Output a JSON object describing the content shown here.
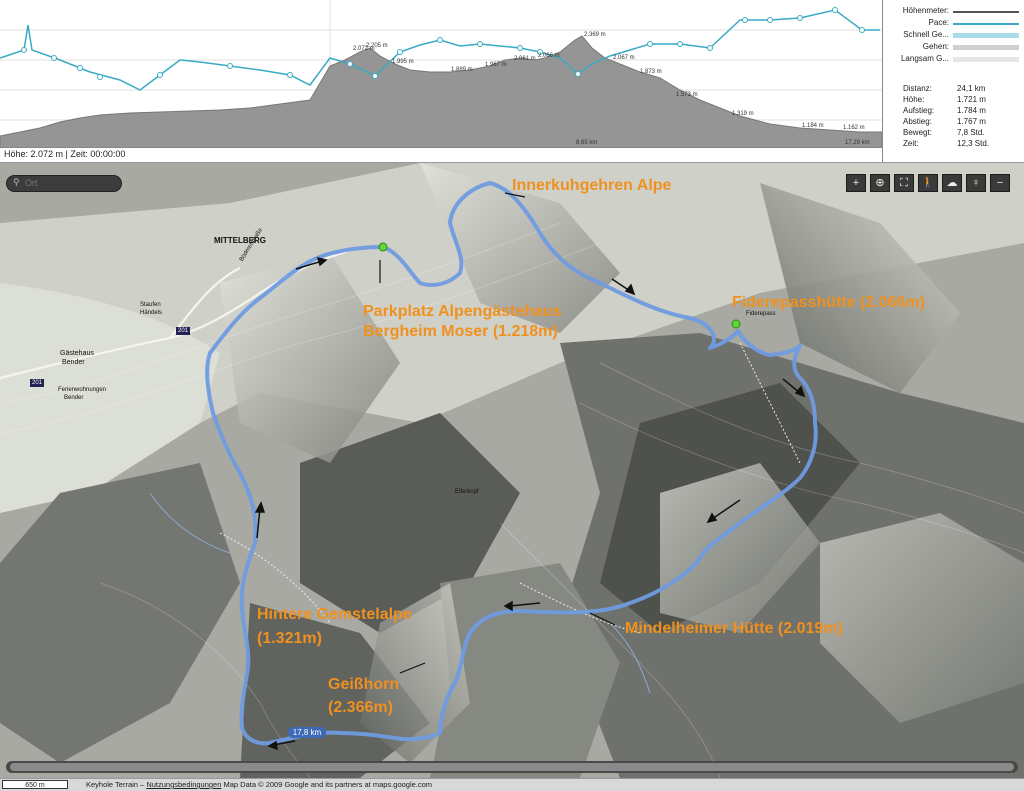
{
  "profile": {
    "status": "Höhe: 2.072 m | Zeit: 00:00:00",
    "peak_labels": [
      "2.072 m",
      "2.205 m",
      "1.995 m",
      "1.889 m",
      "1.967 m",
      "2.061 m",
      "2.066 m",
      "2.369 m",
      "2.067 m",
      "1.873 m",
      "1.573 m",
      "1.319 m",
      "1.184 m",
      "1.162 m"
    ],
    "distance_labels": [
      "8,65 km",
      "17,29 km"
    ],
    "colors": {
      "elevation_fill": "#8f8f8f",
      "pace_line": "#3aaac4",
      "grid": "#dddddd"
    }
  },
  "legend": {
    "items": [
      {
        "label": "Höhenmeter:",
        "color": "#555555"
      },
      {
        "label": "Pace:",
        "color": "#3aaac4"
      },
      {
        "label": "Schnell Ge...",
        "color": "#aadbe8"
      },
      {
        "label": "Gehen:",
        "color": "#d0d0d0"
      },
      {
        "label": "Langsam G...",
        "color": "#e6e6e6"
      }
    ],
    "stats": [
      {
        "key": "Distanz:",
        "value": "24,1 km"
      },
      {
        "key": "Höhe:",
        "value": "1.721 m"
      },
      {
        "key": "Aufstieg:",
        "value": "1.784 m"
      },
      {
        "key": "Abstieg:",
        "value": "1.767 m"
      },
      {
        "key": "Bewegt:",
        "value": "7,8 Std."
      },
      {
        "key": "Zeit:",
        "value": "12,3 Std."
      }
    ]
  },
  "map": {
    "search_placeholder": "Ort",
    "toolbar": [
      "+",
      "⊕",
      "⛶",
      "🚶",
      "☁",
      "♀",
      "−"
    ],
    "labels": {
      "innerkuhgehren": "Innerkuhgehren Alpe",
      "parkplatz_line1": "Parkplatz Alpengästehaus",
      "parkplatz_line2": "Bergheim Moser (1.218m)",
      "fiderepass": "Fiderepasshütte (2.066m)",
      "mindelheimer": "Mindelheimer Hütte (2.019m)",
      "hintere_line1": "Hintere Gemstelalpe",
      "hintere_line2": "(1.321m)",
      "geisshorn_line1": "Geißhorn",
      "geisshorn_line2": "(2.366m)"
    },
    "towns": {
      "mittelberg": "MITTELBERG",
      "gaestehaus": "Gästehaus",
      "bender": "Bender",
      "ferienwohnungen": "Ferienwohnungen",
      "bender2": "Bender",
      "staufen": "Staufen",
      "haendels": "Händels",
      "bodmerstrasse": "Bödmerstraße",
      "elferkopf": "Elferkopf",
      "fiderepass_small": "Fiderepass"
    },
    "road_number": "201",
    "distance_marker": "17,8 km",
    "route_color": "#6f9be0",
    "label_color": "#f0911f"
  },
  "footer": {
    "scale": "650 m",
    "credit_prefix": "Keyhole Terrain –",
    "terms_link": "Nutzungsbedingungen",
    "credit_suffix": "Map Data © 2009 Google and its partners at maps.google.com"
  }
}
